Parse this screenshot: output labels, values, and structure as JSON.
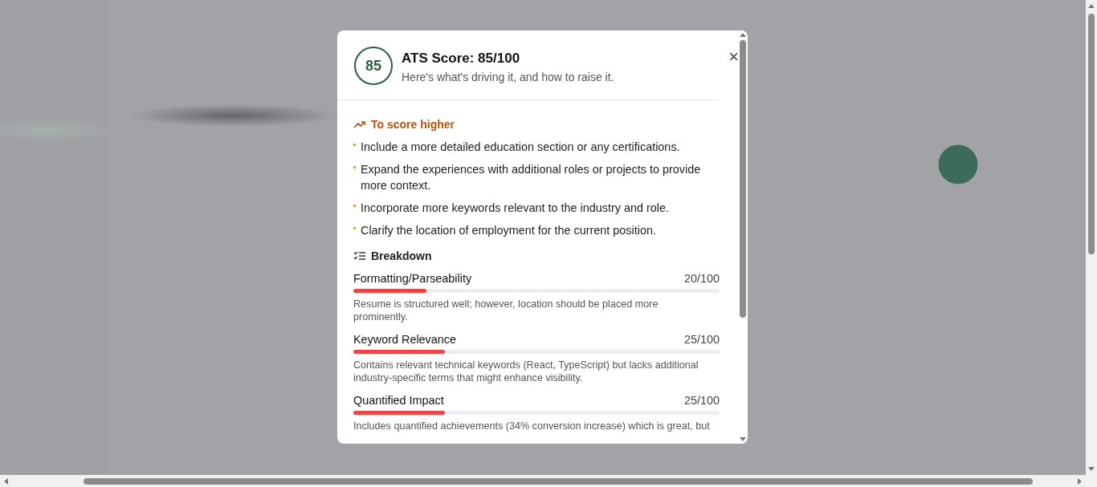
{
  "dialog": {
    "score": "85",
    "title": "ATS Score: 85/100",
    "subtitle": "Here's what's driving it, and how to raise it.",
    "close": "×",
    "tips_heading": "To score higher",
    "tips": [
      "Include a more detailed education section or any certifications.",
      "Expand the experiences with additional roles or projects to provide more context.",
      "Incorporate more keywords relevant to the industry and role.",
      "Clarify the location of employment for the current position."
    ],
    "breakdown_heading": "Breakdown",
    "breakdown": [
      {
        "name": "Formatting/Parseability",
        "score": "20/100",
        "level": 0.2,
        "note": "Resume is structured well; however, location should be placed more prominently."
      },
      {
        "name": "Keyword Relevance",
        "score": "25/100",
        "level": 0.25,
        "note": "Contains relevant technical keywords (React, TypeScript) but lacks additional industry-specific terms that might enhance visibility."
      },
      {
        "name": "Quantified Impact",
        "score": "25/100",
        "level": 0.25,
        "note": "Includes quantified achievements (34% conversion increase) which is great, but"
      }
    ]
  }
}
